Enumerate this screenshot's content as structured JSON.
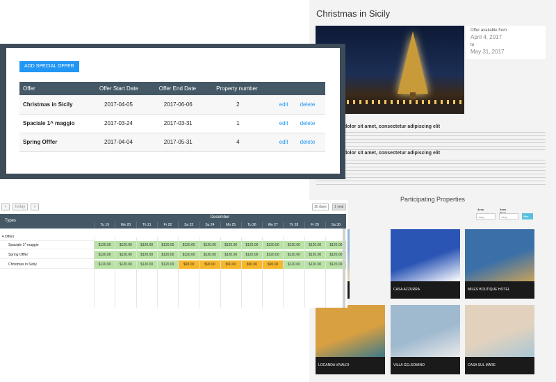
{
  "detail": {
    "title": "Christmas in Sicily",
    "availability": {
      "from_label": "Offer available from",
      "from_date": "April 4, 2017",
      "to_label": "to",
      "to_date": "May 31, 2017"
    },
    "heading1": "dolor sit amet, consectetur adipiscing elit",
    "heading2": "dolor sit amet, consectetur adipiscing elit",
    "participating_title": "Participating Properties",
    "filters": {
      "area_label": "Area",
      "area_type_label": "Area Type",
      "area_value": "-Any-",
      "area_type_value": "-Any-",
      "button": "filter"
    },
    "properties": [
      {
        "name": "",
        "colors": [
          "#8fb6d8",
          "#e8d9a8"
        ]
      },
      {
        "name": "CASA AZZURRA",
        "colors": [
          "#2b55b5",
          "#ffffff"
        ]
      },
      {
        "name": "MILES BOUTIQUE HOTEL",
        "colors": [
          "#3a6fa8",
          "#c9a25a"
        ]
      },
      {
        "name": "LOCANDA VIVALDI",
        "colors": [
          "#d9a041",
          "#3d7a8a"
        ]
      },
      {
        "name": "VILLA GELSOMINO",
        "colors": [
          "#9fb9cf",
          "#e9e9e9"
        ]
      },
      {
        "name": "CASA SUL MARE",
        "colors": [
          "#e2d2bd",
          "#a9c6d6"
        ]
      }
    ]
  },
  "offers_panel": {
    "add_button": "ADD SPECIAL OFFER",
    "columns": [
      "Offer",
      "Offer Start Date",
      "Offer End Date",
      "Property number",
      "",
      ""
    ],
    "rows": [
      {
        "offer": "Christmas in Sicily",
        "start": "2017-04-05",
        "end": "2017-06-06",
        "property_number": "2",
        "edit": "edit",
        "delete": "delete"
      },
      {
        "offer": "Spaciale 1^ maggio",
        "start": "2017-03-24",
        "end": "2017-03-31",
        "property_number": "1",
        "edit": "edit",
        "delete": "delete"
      },
      {
        "offer": "Spring Offfer",
        "start": "2017-04-04",
        "end": "2017-05-31",
        "property_number": "4",
        "edit": "edit",
        "delete": "delete"
      }
    ]
  },
  "calendar": {
    "prev": "‹",
    "today": "today",
    "next": "›",
    "range_30": "30 days",
    "range_1y": "1 year",
    "types_label": "Types",
    "month": "December",
    "days": [
      "Tu 19",
      "We 20",
      "Th 21",
      "Fr 22",
      "Sa 23",
      "Su 24",
      "Mo 25",
      "Tu 26",
      "We 27",
      "Th 28",
      "Fr 29",
      "Sa 30"
    ],
    "group": "Offers",
    "rows": [
      {
        "label": "Spaciale 1^ maggio",
        "prices": [
          "$120.00",
          "$120.00",
          "$120.00",
          "$120.00",
          "$120.00",
          "$120.00",
          "$120.00",
          "$120.00",
          "$120.00",
          "$120.00",
          "$120.00",
          "$120.00"
        ],
        "highlight": []
      },
      {
        "label": "Spring Offfer",
        "prices": [
          "$120.00",
          "$120.00",
          "$120.00",
          "$120.00",
          "$120.00",
          "$120.00",
          "$120.00",
          "$120.00",
          "$120.00",
          "$120.00",
          "$120.00",
          "$120.00"
        ],
        "highlight": []
      },
      {
        "label": "Christmas in Sicily",
        "prices": [
          "$120.00",
          "$120.00",
          "$120.00",
          "$120.00",
          "$90.00",
          "$90.00",
          "$90.00",
          "$90.00",
          "$90.00",
          "$120.00",
          "$120.00",
          "$120.00"
        ],
        "highlight": [
          4,
          5,
          6,
          7,
          8
        ]
      }
    ],
    "colors": {
      "normal": "#b9e3a6",
      "highlight": "#f7b728"
    }
  }
}
